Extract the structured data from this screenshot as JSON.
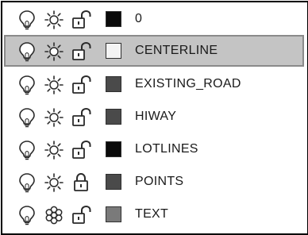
{
  "layers": [
    {
      "name": "0",
      "on": "bulb-icon",
      "freeze": "sun-icon",
      "lock": "lock-open-icon",
      "color": "#0a0a0a",
      "selected": false
    },
    {
      "name": "CENTERLINE",
      "on": "bulb-icon",
      "freeze": "sun-icon",
      "lock": "lock-open-icon",
      "color": "#f4f4f4",
      "selected": true
    },
    {
      "name": "EXISTING_ROAD",
      "on": "bulb-icon",
      "freeze": "sun-icon",
      "lock": "lock-open-icon",
      "color": "#4a4a4a",
      "selected": false
    },
    {
      "name": "HIWAY",
      "on": "bulb-icon",
      "freeze": "sun-icon",
      "lock": "lock-open-icon",
      "color": "#4a4a4a",
      "selected": false
    },
    {
      "name": "LOTLINES",
      "on": "bulb-icon",
      "freeze": "sun-icon",
      "lock": "lock-open-icon",
      "color": "#0a0a0a",
      "selected": false
    },
    {
      "name": "POINTS",
      "on": "bulb-icon",
      "freeze": "sun-icon",
      "lock": "lock-closed-icon",
      "color": "#4a4a4a",
      "selected": false
    },
    {
      "name": "TEXT",
      "on": "bulb-icon",
      "freeze": "snowflake-icon",
      "lock": "lock-open-icon",
      "color": "#7a7a7a",
      "selected": false
    }
  ]
}
